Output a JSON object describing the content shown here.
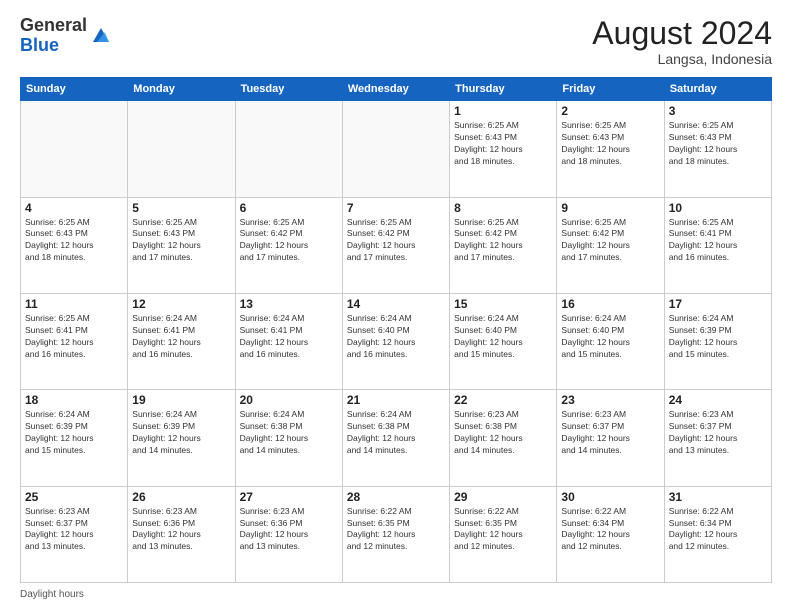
{
  "header": {
    "logo_general": "General",
    "logo_blue": "Blue",
    "month_year": "August 2024",
    "location": "Langsa, Indonesia"
  },
  "footer": {
    "daylight_label": "Daylight hours"
  },
  "weekdays": [
    "Sunday",
    "Monday",
    "Tuesday",
    "Wednesday",
    "Thursday",
    "Friday",
    "Saturday"
  ],
  "weeks": [
    [
      {
        "day": "",
        "info": ""
      },
      {
        "day": "",
        "info": ""
      },
      {
        "day": "",
        "info": ""
      },
      {
        "day": "",
        "info": ""
      },
      {
        "day": "1",
        "info": "Sunrise: 6:25 AM\nSunset: 6:43 PM\nDaylight: 12 hours\nand 18 minutes."
      },
      {
        "day": "2",
        "info": "Sunrise: 6:25 AM\nSunset: 6:43 PM\nDaylight: 12 hours\nand 18 minutes."
      },
      {
        "day": "3",
        "info": "Sunrise: 6:25 AM\nSunset: 6:43 PM\nDaylight: 12 hours\nand 18 minutes."
      }
    ],
    [
      {
        "day": "4",
        "info": "Sunrise: 6:25 AM\nSunset: 6:43 PM\nDaylight: 12 hours\nand 18 minutes."
      },
      {
        "day": "5",
        "info": "Sunrise: 6:25 AM\nSunset: 6:43 PM\nDaylight: 12 hours\nand 17 minutes."
      },
      {
        "day": "6",
        "info": "Sunrise: 6:25 AM\nSunset: 6:42 PM\nDaylight: 12 hours\nand 17 minutes."
      },
      {
        "day": "7",
        "info": "Sunrise: 6:25 AM\nSunset: 6:42 PM\nDaylight: 12 hours\nand 17 minutes."
      },
      {
        "day": "8",
        "info": "Sunrise: 6:25 AM\nSunset: 6:42 PM\nDaylight: 12 hours\nand 17 minutes."
      },
      {
        "day": "9",
        "info": "Sunrise: 6:25 AM\nSunset: 6:42 PM\nDaylight: 12 hours\nand 17 minutes."
      },
      {
        "day": "10",
        "info": "Sunrise: 6:25 AM\nSunset: 6:41 PM\nDaylight: 12 hours\nand 16 minutes."
      }
    ],
    [
      {
        "day": "11",
        "info": "Sunrise: 6:25 AM\nSunset: 6:41 PM\nDaylight: 12 hours\nand 16 minutes."
      },
      {
        "day": "12",
        "info": "Sunrise: 6:24 AM\nSunset: 6:41 PM\nDaylight: 12 hours\nand 16 minutes."
      },
      {
        "day": "13",
        "info": "Sunrise: 6:24 AM\nSunset: 6:41 PM\nDaylight: 12 hours\nand 16 minutes."
      },
      {
        "day": "14",
        "info": "Sunrise: 6:24 AM\nSunset: 6:40 PM\nDaylight: 12 hours\nand 16 minutes."
      },
      {
        "day": "15",
        "info": "Sunrise: 6:24 AM\nSunset: 6:40 PM\nDaylight: 12 hours\nand 15 minutes."
      },
      {
        "day": "16",
        "info": "Sunrise: 6:24 AM\nSunset: 6:40 PM\nDaylight: 12 hours\nand 15 minutes."
      },
      {
        "day": "17",
        "info": "Sunrise: 6:24 AM\nSunset: 6:39 PM\nDaylight: 12 hours\nand 15 minutes."
      }
    ],
    [
      {
        "day": "18",
        "info": "Sunrise: 6:24 AM\nSunset: 6:39 PM\nDaylight: 12 hours\nand 15 minutes."
      },
      {
        "day": "19",
        "info": "Sunrise: 6:24 AM\nSunset: 6:39 PM\nDaylight: 12 hours\nand 14 minutes."
      },
      {
        "day": "20",
        "info": "Sunrise: 6:24 AM\nSunset: 6:38 PM\nDaylight: 12 hours\nand 14 minutes."
      },
      {
        "day": "21",
        "info": "Sunrise: 6:24 AM\nSunset: 6:38 PM\nDaylight: 12 hours\nand 14 minutes."
      },
      {
        "day": "22",
        "info": "Sunrise: 6:23 AM\nSunset: 6:38 PM\nDaylight: 12 hours\nand 14 minutes."
      },
      {
        "day": "23",
        "info": "Sunrise: 6:23 AM\nSunset: 6:37 PM\nDaylight: 12 hours\nand 14 minutes."
      },
      {
        "day": "24",
        "info": "Sunrise: 6:23 AM\nSunset: 6:37 PM\nDaylight: 12 hours\nand 13 minutes."
      }
    ],
    [
      {
        "day": "25",
        "info": "Sunrise: 6:23 AM\nSunset: 6:37 PM\nDaylight: 12 hours\nand 13 minutes."
      },
      {
        "day": "26",
        "info": "Sunrise: 6:23 AM\nSunset: 6:36 PM\nDaylight: 12 hours\nand 13 minutes."
      },
      {
        "day": "27",
        "info": "Sunrise: 6:23 AM\nSunset: 6:36 PM\nDaylight: 12 hours\nand 13 minutes."
      },
      {
        "day": "28",
        "info": "Sunrise: 6:22 AM\nSunset: 6:35 PM\nDaylight: 12 hours\nand 12 minutes."
      },
      {
        "day": "29",
        "info": "Sunrise: 6:22 AM\nSunset: 6:35 PM\nDaylight: 12 hours\nand 12 minutes."
      },
      {
        "day": "30",
        "info": "Sunrise: 6:22 AM\nSunset: 6:34 PM\nDaylight: 12 hours\nand 12 minutes."
      },
      {
        "day": "31",
        "info": "Sunrise: 6:22 AM\nSunset: 6:34 PM\nDaylight: 12 hours\nand 12 minutes."
      }
    ]
  ]
}
